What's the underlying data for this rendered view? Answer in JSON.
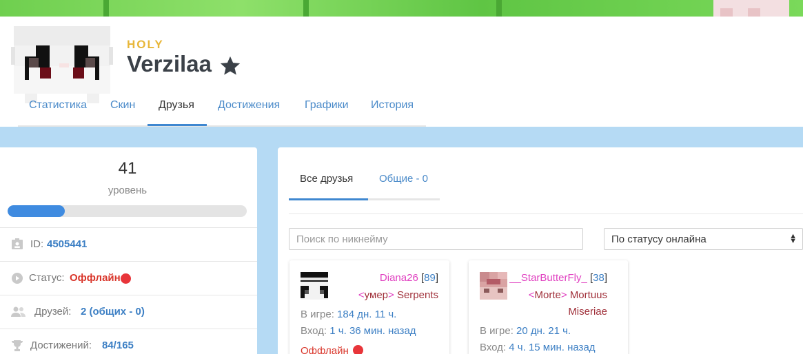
{
  "profile": {
    "rank": "HOLY",
    "nickname": "Verzilaa"
  },
  "tabs": [
    {
      "label": "Статистика"
    },
    {
      "label": "Скин"
    },
    {
      "label": "Друзья"
    },
    {
      "label": "Достижения"
    },
    {
      "label": "Графики"
    },
    {
      "label": "История"
    }
  ],
  "active_tab": "Друзья",
  "stats": {
    "level": "41",
    "level_label": "уровень",
    "level_progress_percent": 24,
    "id_label": "ID:",
    "id_value": "4505441",
    "status_label": "Статус:",
    "status_value": "Оффлайн",
    "friends_label": "Друзей:",
    "friends_value": "2 (общих - 0)",
    "achievements_label": "Достижений:",
    "achievements_value": "84/165"
  },
  "friends_panel": {
    "tab_all": "Все друзья",
    "tab_common": "Общие - 0",
    "search_placeholder": "Поиск по никнейму",
    "sort_selected": "По статусу онлайна",
    "friends": [
      {
        "name": "Diana26",
        "level": "89",
        "clan_tag": "умер",
        "clan_name": "Serpents",
        "in_game_label": "В игре:",
        "in_game": "184 дн. 11 ч.",
        "login_label": "Вход:",
        "login": "1 ч. 36 мин. назад",
        "status": "Оффлайн"
      },
      {
        "name": "__StarButterFly_",
        "level": "38",
        "clan_tag": "Morte",
        "clan_name": "Mortuus Miseriae",
        "in_game_label": "В игре:",
        "in_game": "20 дн. 21 ч.",
        "login_label": "Вход:",
        "login": "4 ч. 15 мин. назад"
      }
    ]
  },
  "colors": {
    "accent": "#3f87d0",
    "link": "#3c7fc4",
    "rank": "#e8b73a",
    "offline": "#e8353a",
    "background": "#b5daf4",
    "friend_name": "#e040c0",
    "clan": "#a0303a"
  },
  "icons": [
    "star-icon",
    "id-card-icon",
    "play-circle-icon",
    "users-icon",
    "trophy-icon",
    "sort-caret-icon"
  ]
}
